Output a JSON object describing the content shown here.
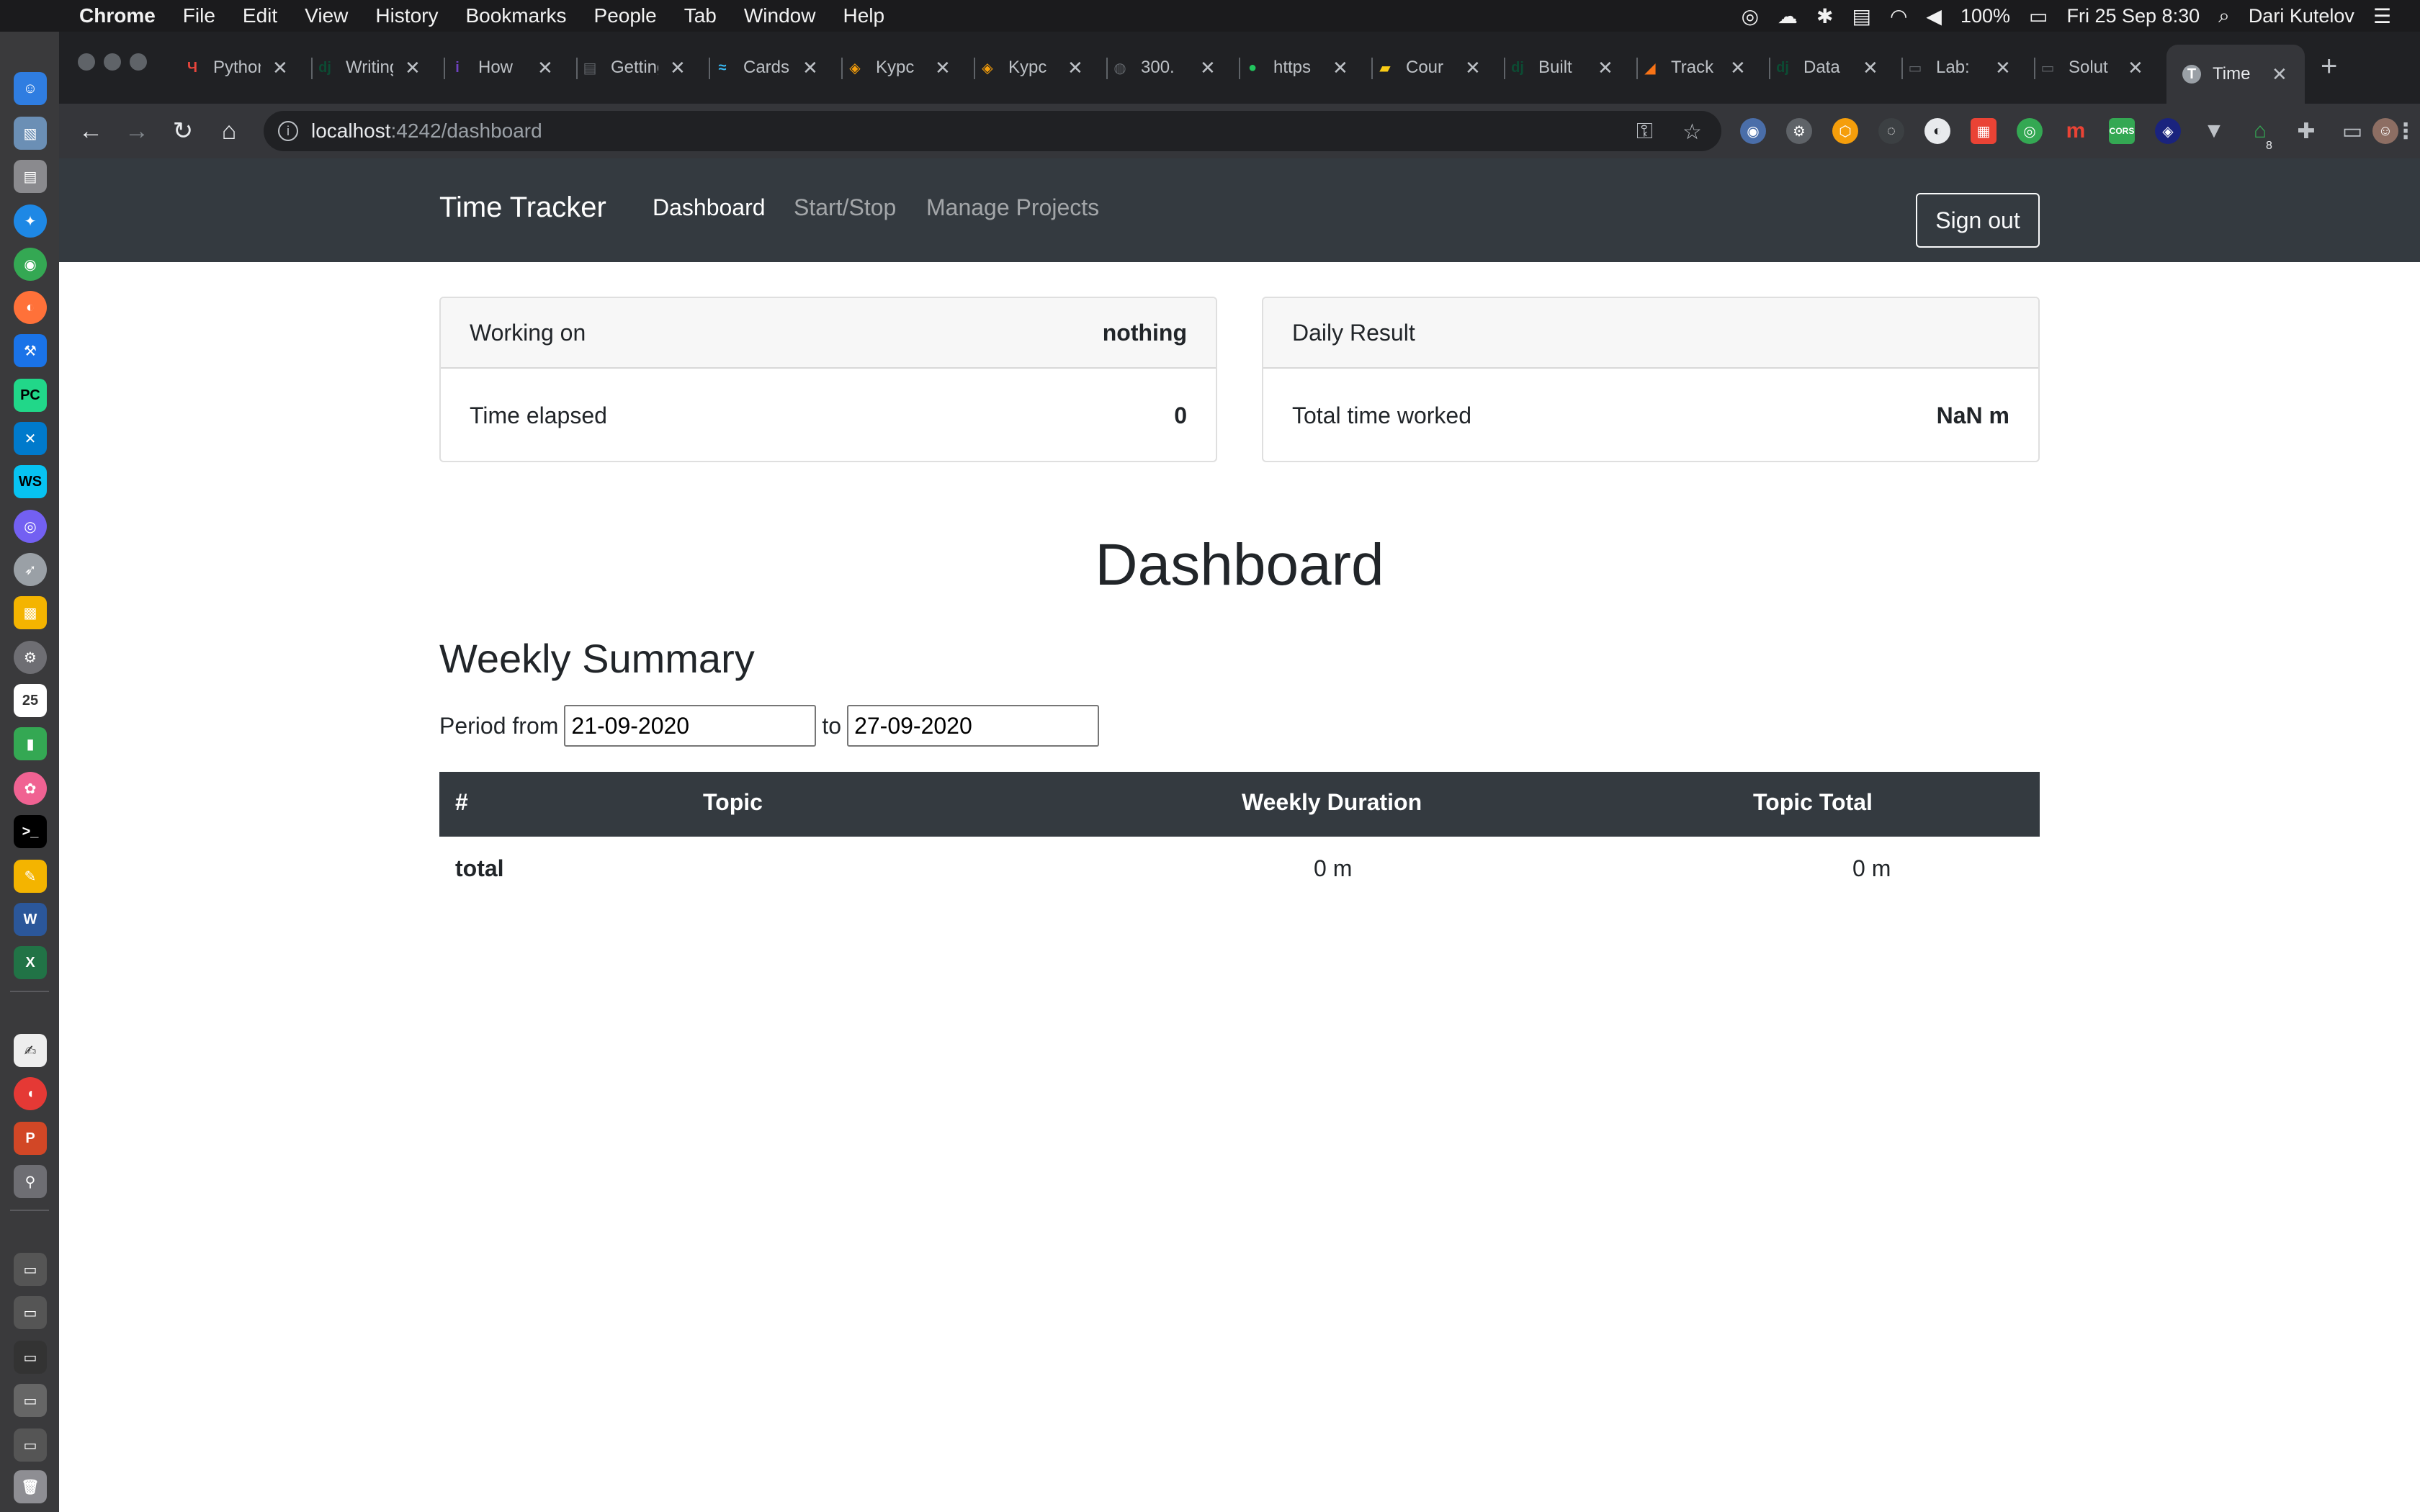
{
  "menubar": {
    "app": "Chrome",
    "items": [
      "File",
      "Edit",
      "View",
      "History",
      "Bookmarks",
      "People",
      "Tab",
      "Window",
      "Help"
    ],
    "battery": "100%",
    "datetime": "Fri 25 Sep  8:30",
    "user": "Dari Kutelov"
  },
  "tabs": [
    {
      "title": "Python",
      "favicon": "Ч",
      "color": "#e8453c"
    },
    {
      "title": "Writing",
      "favicon": "dj",
      "color": "#0c4b33"
    },
    {
      "title": "How",
      "favicon": "i",
      "color": "#6f42c1"
    },
    {
      "title": "Getting",
      "favicon": "▤",
      "color": "#5f6368"
    },
    {
      "title": "Cards",
      "favicon": "≈",
      "color": "#38bdf8"
    },
    {
      "title": "Kypc",
      "favicon": "◈",
      "color": "#f59e0b"
    },
    {
      "title": "Kypc",
      "favicon": "◈",
      "color": "#f59e0b"
    },
    {
      "title": "300.",
      "favicon": "◍",
      "color": "#5f6368"
    },
    {
      "title": "https",
      "favicon": "●",
      "color": "#22c55e"
    },
    {
      "title": "Cour",
      "favicon": "▰",
      "color": "#facc15"
    },
    {
      "title": "Built",
      "favicon": "dj",
      "color": "#0c4b33"
    },
    {
      "title": "Track",
      "favicon": "◢",
      "color": "#f97316"
    },
    {
      "title": "Data",
      "favicon": "dj",
      "color": "#0c4b33"
    },
    {
      "title": "Lab:",
      "favicon": "▭",
      "color": "#5f6368"
    },
    {
      "title": "Solut",
      "favicon": "▭",
      "color": "#5f6368"
    },
    {
      "title": "Time",
      "favicon": "T",
      "color": "#9aa0a6"
    }
  ],
  "address": {
    "host": "localhost",
    "path": ":4242/dashboard"
  },
  "extensions_badge": "8",
  "app": {
    "brand": "Time Tracker",
    "nav": [
      "Dashboard",
      "Start/Stop",
      "Manage Projects"
    ],
    "signout": "Sign out"
  },
  "working_card": {
    "header_label": "Working on",
    "header_value": "nothing",
    "body_label": "Time elapsed",
    "body_value": "0"
  },
  "daily_card": {
    "header_label": "Daily Result",
    "body_label": "Total time worked",
    "body_value": "NaN m"
  },
  "page_title": "Dashboard",
  "section_title": "Weekly Summary",
  "period": {
    "from_label": "Period from",
    "from_value": "21-09-2020",
    "to_label": "to",
    "to_value": "27-09-2020"
  },
  "table": {
    "headers": [
      "#",
      "Topic",
      "Weekly Duration",
      "Topic Total"
    ],
    "total_row": {
      "label": "total",
      "weekly": "0 m",
      "topic_total": "0 m"
    }
  }
}
